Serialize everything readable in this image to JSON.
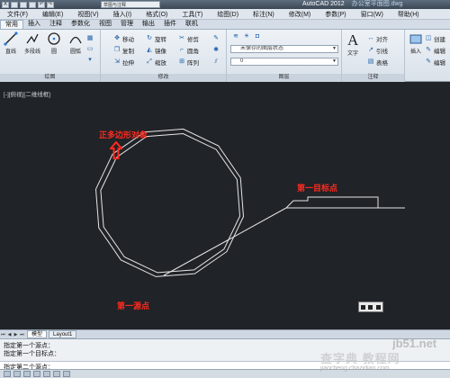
{
  "titlebar": {
    "workspace": "草图与注释",
    "app_name": "AutoCAD 2012",
    "file_name": "办公室平面图.dwg"
  },
  "menubar": {
    "items": [
      "文件(F)",
      "编辑(E)",
      "视图(V)",
      "插入(I)",
      "格式(O)",
      "工具(T)",
      "绘图(D)",
      "标注(N)",
      "修改(M)",
      "参数(P)",
      "窗口(W)",
      "帮助(H)"
    ]
  },
  "ribbon_tabs": {
    "items": [
      "常用",
      "插入",
      "注释",
      "参数化",
      "视图",
      "管理",
      "输出",
      "插件",
      "联机"
    ]
  },
  "ribbon": {
    "draw": {
      "title": "绘图",
      "line": "直线",
      "polyline": "多段线",
      "circle": "圆",
      "arc": "圆弧"
    },
    "modify": {
      "title": "修改",
      "move": "移动",
      "copy": "复制",
      "stretch": "拉伸",
      "rotate": "旋转",
      "mirror": "镜像",
      "scale": "缩放",
      "trim": "修剪",
      "fillet": "圆角",
      "array": "阵列"
    },
    "layers": {
      "title": "图层",
      "layer_state": "未保存的图层状态",
      "current_layer": "0"
    },
    "annotation": {
      "title": "注释",
      "text": "文字",
      "align": "对齐",
      "leader": "引线",
      "table": "表格"
    },
    "block": {
      "insert": "插入",
      "create": "创建",
      "edit": "编辑",
      "edit_attr": "编辑"
    }
  },
  "viewport": {
    "label": "[-][俯视][二维线框]",
    "annotations": {
      "polygon": "正多边形对象",
      "first_target": "第一目标点",
      "first_source": "第一源点"
    }
  },
  "layout_tabs": {
    "items": [
      "模型",
      "Layout1"
    ]
  },
  "command_line": {
    "lines": [
      "指定第一个源点：",
      "指定第一个目标点：",
      "指定第二个源点："
    ]
  },
  "watermark": {
    "site": "jb51.net",
    "brand": "查字典 教程网",
    "url": "jiaocheng.chazidian.com"
  },
  "colors": {
    "annotation_red": "#ff2a1f",
    "viewport_bg": "#202327",
    "linework": "#e6e6e6"
  }
}
